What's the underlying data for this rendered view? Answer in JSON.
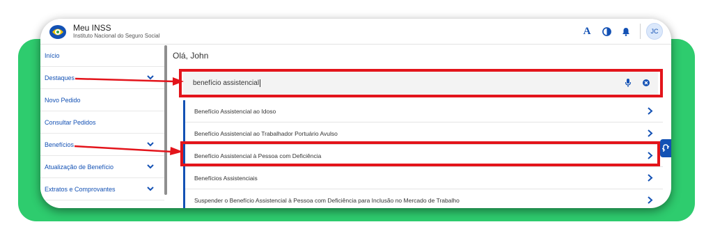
{
  "header": {
    "title": "Meu INSS",
    "subtitle": "Instituto Nacional do Seguro Social",
    "font_size_icon_label": "A",
    "avatar_initials": "JC",
    "icons": [
      "font-size-icon",
      "contrast-icon",
      "bell-icon"
    ]
  },
  "sidebar": {
    "items": [
      {
        "label": "Início",
        "has_chevron": false
      },
      {
        "label": "Destaques",
        "has_chevron": true
      },
      {
        "label": "Novo Pedido",
        "has_chevron": false
      },
      {
        "label": "Consultar Pedidos",
        "has_chevron": false
      },
      {
        "label": "Benefícios",
        "has_chevron": true
      },
      {
        "label": "Atualização de Benefício",
        "has_chevron": true
      },
      {
        "label": "Extratos e Comprovantes",
        "has_chevron": true
      }
    ]
  },
  "main": {
    "greeting": "Olá, John",
    "search": {
      "value": "benefício assistencial"
    },
    "results": [
      "Benefício Assistencial ao Idoso",
      "Benefício Assistencial ao Trabalhador Portuário Avulso",
      "Benefício Assistencial à Pessoa com Deficiência",
      "Benefícios Assistenciais",
      "Suspender o Benefício Assistencial à Pessoa com Deficiência para Inclusão no Mercado de Trabalho"
    ]
  },
  "colors": {
    "brand_blue": "#1351b4",
    "highlight_red": "#e3141b",
    "background_green": "#2ecc6e"
  }
}
